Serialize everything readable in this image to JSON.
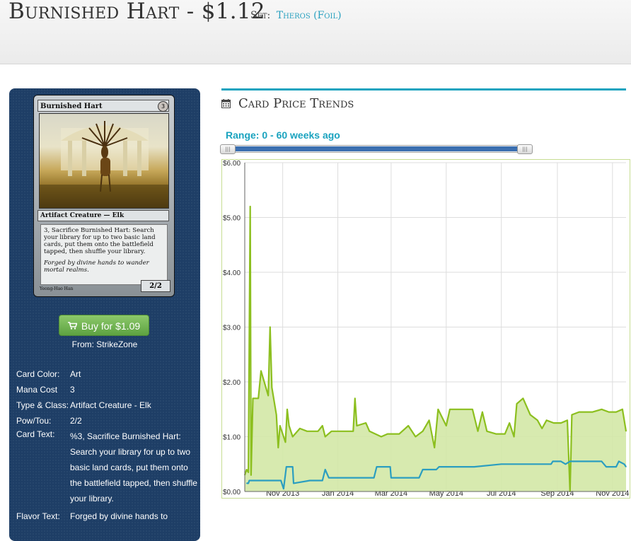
{
  "header": {
    "title": "Burnished Hart - $1.12",
    "set_label": "Set:",
    "set_name": "Theros (Foil)"
  },
  "card": {
    "name": "Burnished Hart",
    "cost": "3",
    "type_line": "Artifact Creature — Elk",
    "rules_text": "3, Sacrifice Burnished Hart: Search your library for up to two basic land cards, put them onto the battlefield tapped, then shuffle your library.",
    "flavor": "Forged by divine hands to wander mortal realms.",
    "pt": "2/2",
    "artist": "Yeong-Hao Han"
  },
  "buy": {
    "label": "Buy for $1.09",
    "from": "From: StrikeZone"
  },
  "details": [
    {
      "k": "Card Color:",
      "v": "Art"
    },
    {
      "k": "Mana Cost",
      "v": "3"
    },
    {
      "k": "Type & Class:",
      "v": "Artifact Creature - Elk"
    },
    {
      "k": "Pow/Tou:",
      "v": "2/2"
    },
    {
      "k": "Card Text:",
      "v": "%3, Sacrifice Burnished Hart: Search your library for up to two basic land cards, put them onto the battlefield tapped, then shuffle your library."
    },
    {
      "k": "Flavor Text:",
      "v": "Forged by divine hands to"
    }
  ],
  "chart_section": {
    "title": "Card Price Trends",
    "range_label": "Range: 0 - 60 weeks ago",
    "range_weeks": [
      0,
      60
    ]
  },
  "colors": {
    "accent": "#1aa3bf",
    "sidebar": "#1e3e66",
    "buy_button": "#6aaf4b",
    "series_foil": "#8cbf1f",
    "series_fill": "#d3e8a6",
    "series_regular": "#2b9ec0"
  },
  "chart_data": {
    "type": "area",
    "title": "",
    "xlabel": "",
    "ylabel": "",
    "ylim": [
      0,
      6
    ],
    "y_ticks": [
      "$0.00",
      "$1.00",
      "$2.00",
      "$3.00",
      "$4.00",
      "$5.00",
      "$6.00"
    ],
    "y_tick_values": [
      0,
      1,
      2,
      3,
      4,
      5,
      6
    ],
    "x_ticks": [
      "Nov 2013",
      "Jan 2014",
      "Mar 2014",
      "May 2014",
      "Jul 2014",
      "Sep 2014",
      "Nov 2014"
    ],
    "x_tick_values": [
      "2013-11-01",
      "2014-01-01",
      "2014-03-01",
      "2014-05-01",
      "2014-07-01",
      "2014-09-01",
      "2014-11-01"
    ],
    "xlim": [
      "2013-09-20",
      "2014-11-16"
    ],
    "grid": true,
    "series": [
      {
        "values": [
          [
            "2013-09-20",
            0.3
          ],
          [
            "2013-09-22",
            0.4
          ],
          [
            "2013-09-24",
            0.35
          ],
          [
            "2013-09-26",
            5.2
          ],
          [
            "2013-09-27",
            0.3
          ],
          [
            "2013-09-29",
            1.7
          ],
          [
            "2013-10-05",
            1.7
          ],
          [
            "2013-10-08",
            2.2
          ],
          [
            "2013-10-16",
            1.75
          ],
          [
            "2013-10-18",
            3.0
          ],
          [
            "2013-10-20",
            1.9
          ],
          [
            "2013-10-25",
            1.4
          ],
          [
            "2013-10-27",
            0.8
          ],
          [
            "2013-10-29",
            1.2
          ],
          [
            "2013-11-04",
            0.9
          ],
          [
            "2013-11-06",
            1.5
          ],
          [
            "2013-11-08",
            1.2
          ],
          [
            "2013-11-12",
            1.0
          ],
          [
            "2013-11-20",
            1.15
          ],
          [
            "2013-11-28",
            1.1
          ],
          [
            "2013-12-10",
            1.1
          ],
          [
            "2013-12-15",
            1.2
          ],
          [
            "2013-12-18",
            1.0
          ],
          [
            "2013-12-25",
            1.1
          ],
          [
            "2014-01-10",
            1.1
          ],
          [
            "2014-01-18",
            1.1
          ],
          [
            "2014-01-20",
            1.7
          ],
          [
            "2014-01-22",
            1.2
          ],
          [
            "2014-02-01",
            1.25
          ],
          [
            "2014-02-05",
            1.1
          ],
          [
            "2014-02-18",
            1.0
          ],
          [
            "2014-02-25",
            1.05
          ],
          [
            "2014-03-10",
            1.05
          ],
          [
            "2014-03-20",
            1.2
          ],
          [
            "2014-03-28",
            1.0
          ],
          [
            "2014-04-05",
            1.1
          ],
          [
            "2014-04-12",
            1.3
          ],
          [
            "2014-04-18",
            0.8
          ],
          [
            "2014-04-22",
            1.5
          ],
          [
            "2014-05-01",
            1.2
          ],
          [
            "2014-05-05",
            1.5
          ],
          [
            "2014-05-15",
            1.5
          ],
          [
            "2014-05-30",
            1.5
          ],
          [
            "2014-06-05",
            1.1
          ],
          [
            "2014-06-10",
            1.45
          ],
          [
            "2014-06-15",
            1.1
          ],
          [
            "2014-06-25",
            1.05
          ],
          [
            "2014-07-05",
            1.05
          ],
          [
            "2014-07-10",
            1.25
          ],
          [
            "2014-07-15",
            1.0
          ],
          [
            "2014-07-18",
            1.6
          ],
          [
            "2014-07-25",
            1.7
          ],
          [
            "2014-08-02",
            1.4
          ],
          [
            "2014-08-10",
            1.3
          ],
          [
            "2014-08-15",
            1.15
          ],
          [
            "2014-08-20",
            1.3
          ],
          [
            "2014-08-28",
            1.25
          ],
          [
            "2014-09-05",
            1.25
          ],
          [
            "2014-09-12",
            1.3
          ],
          [
            "2014-09-15",
            0.0
          ],
          [
            "2014-09-17",
            1.4
          ],
          [
            "2014-09-25",
            1.45
          ],
          [
            "2014-10-10",
            1.45
          ],
          [
            "2014-10-20",
            1.5
          ],
          [
            "2014-10-28",
            1.45
          ],
          [
            "2014-11-05",
            1.45
          ],
          [
            "2014-11-12",
            1.5
          ],
          [
            "2014-11-16",
            1.1
          ]
        ]
      },
      {
        "values": [
          [
            "2013-09-22",
            0.15
          ],
          [
            "2013-09-24",
            0.15
          ],
          [
            "2013-09-25",
            0.2
          ],
          [
            "2013-10-15",
            0.2
          ],
          [
            "2013-10-30",
            0.2
          ],
          [
            "2013-11-02",
            0.05
          ],
          [
            "2013-11-05",
            0.45
          ],
          [
            "2013-11-12",
            0.45
          ],
          [
            "2013-11-13",
            0.15
          ],
          [
            "2013-12-01",
            0.2
          ],
          [
            "2013-12-15",
            0.2
          ],
          [
            "2013-12-18",
            0.4
          ],
          [
            "2013-12-22",
            0.25
          ],
          [
            "2014-01-10",
            0.25
          ],
          [
            "2014-02-10",
            0.25
          ],
          [
            "2014-02-13",
            0.45
          ],
          [
            "2014-02-28",
            0.45
          ],
          [
            "2014-03-01",
            0.25
          ],
          [
            "2014-03-20",
            0.25
          ],
          [
            "2014-04-01",
            0.25
          ],
          [
            "2014-04-05",
            0.4
          ],
          [
            "2014-04-20",
            0.4
          ],
          [
            "2014-04-23",
            0.45
          ],
          [
            "2014-06-01",
            0.45
          ],
          [
            "2014-07-01",
            0.5
          ],
          [
            "2014-08-25",
            0.5
          ],
          [
            "2014-08-27",
            0.55
          ],
          [
            "2014-09-05",
            0.55
          ],
          [
            "2014-09-10",
            0.5
          ],
          [
            "2014-09-15",
            0.55
          ],
          [
            "2014-10-20",
            0.55
          ],
          [
            "2014-10-25",
            0.45
          ],
          [
            "2014-11-05",
            0.45
          ],
          [
            "2014-11-08",
            0.55
          ],
          [
            "2014-11-14",
            0.5
          ],
          [
            "2014-11-16",
            0.45
          ]
        ]
      }
    ]
  }
}
